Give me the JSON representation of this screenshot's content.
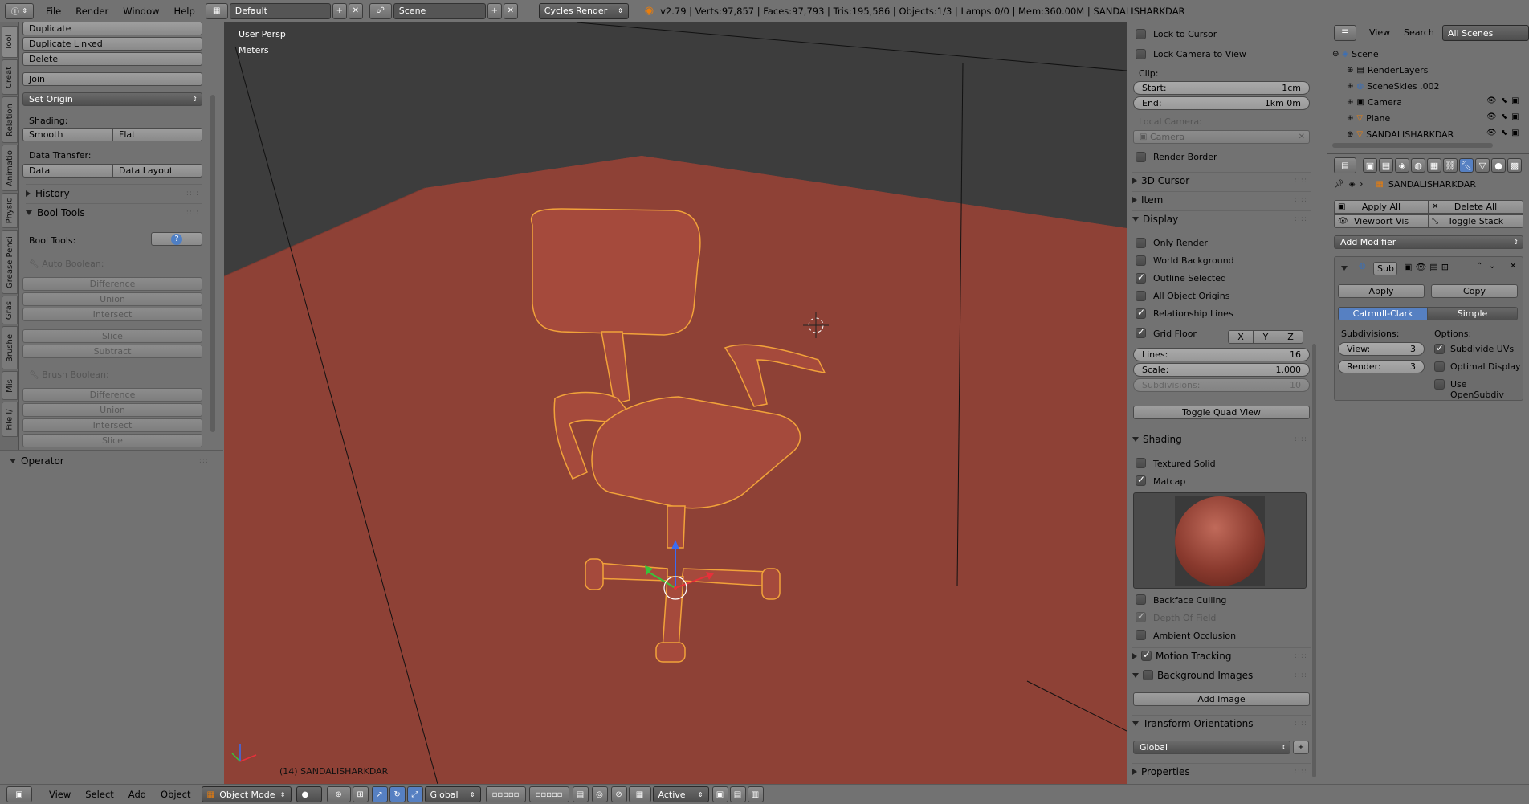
{
  "topbar": {
    "menus": [
      "File",
      "Render",
      "Window",
      "Help"
    ],
    "layout_value": "Default",
    "scene_value": "Scene",
    "render_engine": "Cycles Render",
    "stats": "v2.79 | Verts:97,857 | Faces:97,793 | Tris:195,586 | Objects:1/3 | Lamps:0/0 | Mem:360.00M | SANDALISHARKDAR"
  },
  "left_tabs": [
    "Tool",
    "Creat",
    "Relation",
    "Animatio",
    "Physic",
    "Grease Penci",
    "Gras",
    "Brushe",
    "Mis",
    "File I/"
  ],
  "tool_shelf": {
    "duplicate": "Duplicate",
    "duplicate_linked": "Duplicate Linked",
    "delete": "Delete",
    "join": "Join",
    "set_origin": "Set Origin",
    "shading_label": "Shading:",
    "smooth": "Smooth",
    "flat": "Flat",
    "data_transfer_label": "Data Transfer:",
    "data": "Data",
    "data_layout": "Data Layout",
    "history": "History",
    "bool_tools_panel": "Bool Tools",
    "bool_tools_label": "Bool Tools:",
    "auto_boolean": "Auto Boolean:",
    "auto_ops": [
      "Difference",
      "Union",
      "Intersect",
      "Slice",
      "Subtract"
    ],
    "brush_boolean": "Brush Boolean:",
    "brush_ops": [
      "Difference",
      "Union",
      "Intersect",
      "Slice"
    ],
    "operator": "Operator"
  },
  "viewport": {
    "view_name": "User Persp",
    "units": "Meters",
    "object_label": "(14) SANDALISHARKDAR",
    "floor_color": "#8e4136",
    "bg_color": "#3d3d3d"
  },
  "npanel": {
    "lock_to_cursor": "Lock to Cursor",
    "lock_camera": "Lock Camera to View",
    "clip_label": "Clip:",
    "clip_start_label": "Start:",
    "clip_start_value": "1cm",
    "clip_end_label": "End:",
    "clip_end_value": "1km 0m",
    "local_camera_label": "Local Camera:",
    "local_camera_value": "Camera",
    "render_border": "Render Border",
    "cursor_3d": "3D Cursor",
    "item": "Item",
    "display": "Display",
    "only_render": "Only Render",
    "world_background": "World Background",
    "outline_selected": "Outline Selected",
    "all_object_origins": "All Object Origins",
    "relationship_lines": "Relationship Lines",
    "grid_floor": "Grid Floor",
    "axes": [
      "X",
      "Y",
      "Z"
    ],
    "lines_label": "Lines:",
    "lines_value": "16",
    "scale_label": "Scale:",
    "scale_value": "1.000",
    "subdiv_label": "Subdivisions:",
    "subdiv_value": "10",
    "toggle_quad": "Toggle Quad View",
    "shading": "Shading",
    "textured_solid": "Textured Solid",
    "matcap": "Matcap",
    "backface_culling": "Backface Culling",
    "depth_of_field": "Depth Of Field",
    "ambient_occlusion": "Ambient Occlusion",
    "motion_tracking": "Motion Tracking",
    "background_images": "Background Images",
    "add_image": "Add Image",
    "transform_orientations": "Transform Orientations",
    "orientation_value": "Global",
    "properties": "Properties"
  },
  "outliner": {
    "view_menu": "View",
    "search_menu": "Search",
    "filter_value": "All Scenes",
    "items": [
      "Scene",
      "RenderLayers",
      "SceneSkies .002",
      "Camera",
      "Plane",
      "SANDALISHARKDAR"
    ]
  },
  "properties": {
    "object_name": "SANDALISHARKDAR",
    "apply_all": "Apply All",
    "delete_all": "Delete All",
    "viewport_vis": "Viewport Vis",
    "toggle_stack": "Toggle Stack",
    "add_modifier": "Add Modifier",
    "modifier_name": "Sub",
    "apply": "Apply",
    "copy": "Copy",
    "catmull_clark": "Catmull-Clark",
    "simple": "Simple",
    "subdivisions_label": "Subdivisions:",
    "options_label": "Options:",
    "view_label": "View:",
    "view_value": "3",
    "render_label": "Render:",
    "render_value": "3",
    "subdivide_uvs": "Subdivide UVs",
    "optimal_display": "Optimal Display",
    "use_opensubdiv": "Use OpenSubdiv",
    "accent": "#5680c2"
  },
  "bottombar": {
    "menus": [
      "View",
      "Select",
      "Add",
      "Object"
    ],
    "mode": "Object Mode",
    "orientation": "Global",
    "pivot": "Active"
  }
}
